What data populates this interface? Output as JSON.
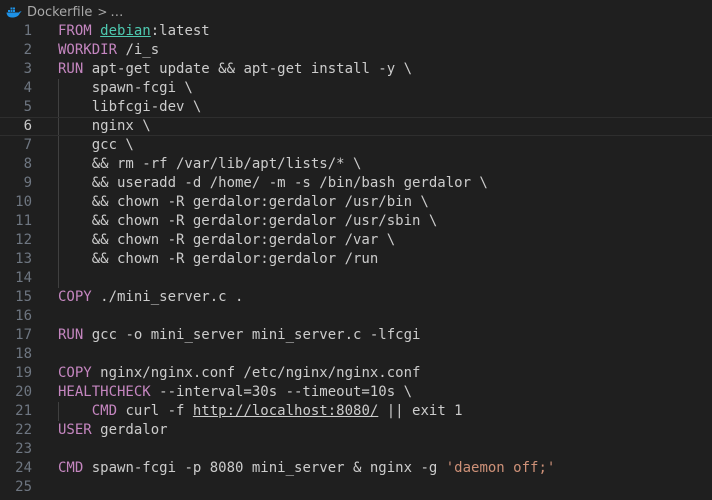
{
  "breadcrumb": {
    "file": "Dockerfile",
    "separator": ">",
    "more": "…"
  },
  "lines": [
    {
      "n": "1",
      "tokens": [
        [
          "kw",
          "FROM"
        ],
        [
          "txt",
          " "
        ],
        [
          "img",
          "debian"
        ],
        [
          "txt",
          ":latest"
        ]
      ]
    },
    {
      "n": "2",
      "tokens": [
        [
          "kw",
          "WORKDIR"
        ],
        [
          "txt",
          " /i_s"
        ]
      ]
    },
    {
      "n": "3",
      "tokens": [
        [
          "kw",
          "RUN"
        ],
        [
          "txt",
          " apt-get update && apt-get install -y \\"
        ]
      ]
    },
    {
      "n": "4",
      "tokens": [
        [
          "txt",
          "    spawn-fcgi \\"
        ]
      ]
    },
    {
      "n": "5",
      "tokens": [
        [
          "txt",
          "    libfcgi-dev \\"
        ]
      ]
    },
    {
      "n": "6",
      "tokens": [
        [
          "txt",
          "    nginx \\"
        ]
      ],
      "current": true
    },
    {
      "n": "7",
      "tokens": [
        [
          "txt",
          "    gcc \\"
        ]
      ]
    },
    {
      "n": "8",
      "tokens": [
        [
          "txt",
          "    && rm -rf /var/lib/apt/lists/* \\"
        ]
      ]
    },
    {
      "n": "9",
      "tokens": [
        [
          "txt",
          "    && useradd -d /home/ -m -s /bin/bash gerdalor \\"
        ]
      ]
    },
    {
      "n": "10",
      "tokens": [
        [
          "txt",
          "    && chown -R gerdalor:gerdalor /usr/bin \\"
        ]
      ]
    },
    {
      "n": "11",
      "tokens": [
        [
          "txt",
          "    && chown -R gerdalor:gerdalor /usr/sbin \\"
        ]
      ]
    },
    {
      "n": "12",
      "tokens": [
        [
          "txt",
          "    && chown -R gerdalor:gerdalor /var \\"
        ]
      ]
    },
    {
      "n": "13",
      "tokens": [
        [
          "txt",
          "    && chown -R gerdalor:gerdalor /run"
        ]
      ]
    },
    {
      "n": "14",
      "tokens": []
    },
    {
      "n": "15",
      "tokens": [
        [
          "kw",
          "COPY"
        ],
        [
          "txt",
          " ./mini_server.c ."
        ]
      ]
    },
    {
      "n": "16",
      "tokens": []
    },
    {
      "n": "17",
      "tokens": [
        [
          "kw",
          "RUN"
        ],
        [
          "txt",
          " gcc -o mini_server mini_server.c -lfcgi"
        ]
      ]
    },
    {
      "n": "18",
      "tokens": []
    },
    {
      "n": "19",
      "tokens": [
        [
          "kw",
          "COPY"
        ],
        [
          "txt",
          " nginx/nginx.conf /etc/nginx/nginx.conf"
        ]
      ]
    },
    {
      "n": "20",
      "tokens": [
        [
          "kw",
          "HEALTHCHECK"
        ],
        [
          "txt",
          " --interval=30s --timeout=10s \\"
        ]
      ]
    },
    {
      "n": "21",
      "tokens": [
        [
          "txt",
          "    "
        ],
        [
          "kw",
          "CMD"
        ],
        [
          "txt",
          " curl -f "
        ],
        [
          "url",
          "http://localhost:8080/"
        ],
        [
          "txt",
          " || exit 1"
        ]
      ]
    },
    {
      "n": "22",
      "tokens": [
        [
          "kw",
          "USER"
        ],
        [
          "txt",
          " gerdalor"
        ]
      ]
    },
    {
      "n": "23",
      "tokens": []
    },
    {
      "n": "24",
      "tokens": [
        [
          "kw",
          "CMD"
        ],
        [
          "txt",
          " spawn-fcgi -p 8080 mini_server & nginx -g "
        ],
        [
          "str",
          "'daemon off;'"
        ]
      ]
    },
    {
      "n": "25",
      "tokens": []
    }
  ],
  "indent_guide_lines": [
    "4",
    "5",
    "6",
    "7",
    "8",
    "9",
    "10",
    "11",
    "12",
    "13",
    "14",
    "21"
  ],
  "colors": {
    "background": "#1f1f1f",
    "keyword": "#c586c0",
    "image_name": "#4ec9b0",
    "string": "#ce9178",
    "text": "#cccccc",
    "line_number": "#6e7681",
    "docker_icon": "#1d91e6"
  },
  "icons": {
    "file_type": "docker-icon"
  }
}
